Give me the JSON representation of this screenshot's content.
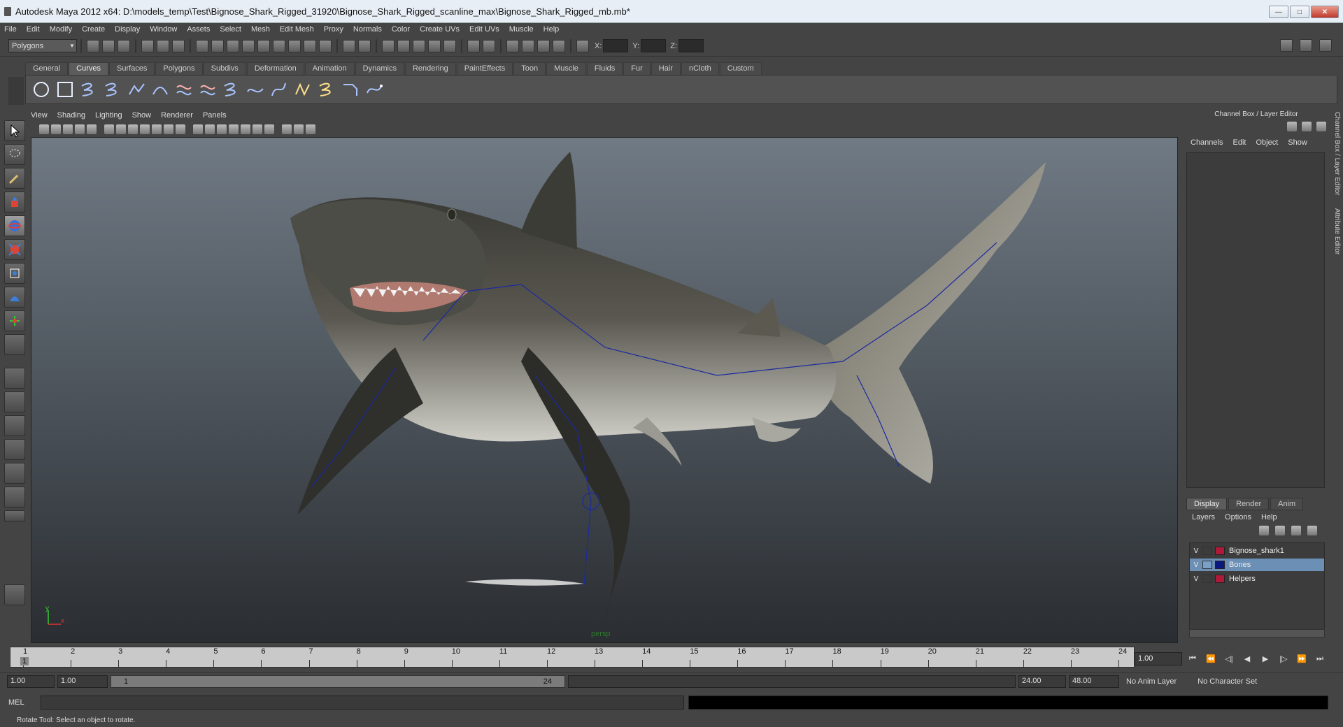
{
  "window": {
    "title": "Autodesk Maya 2012 x64: D:\\models_temp\\Test\\Bignose_Shark_Rigged_31920\\Bignose_Shark_Rigged_scanline_max\\Bignose_Shark_Rigged_mb.mb*",
    "minimize": "—",
    "maximize": "□",
    "close": "✕"
  },
  "menubar": [
    "File",
    "Edit",
    "Modify",
    "Create",
    "Display",
    "Window",
    "Assets",
    "Select",
    "Mesh",
    "Edit Mesh",
    "Proxy",
    "Normals",
    "Color",
    "Create UVs",
    "Edit UVs",
    "Muscle",
    "Help"
  ],
  "status": {
    "mode": "Polygons",
    "x_label": "X:",
    "y_label": "Y:",
    "z_label": "Z:"
  },
  "shelf_tabs": [
    "General",
    "Curves",
    "Surfaces",
    "Polygons",
    "Subdivs",
    "Deformation",
    "Animation",
    "Dynamics",
    "Rendering",
    "PaintEffects",
    "Toon",
    "Muscle",
    "Fluids",
    "Fur",
    "Hair",
    "nCloth",
    "Custom"
  ],
  "active_shelf": "Curves",
  "viewport": {
    "menu": [
      "View",
      "Shading",
      "Lighting",
      "Show",
      "Renderer",
      "Panels"
    ],
    "camera": "persp",
    "axis_y": "y",
    "axis_x": "x"
  },
  "channel_box": {
    "title": "Channel Box / Layer Editor",
    "menu": [
      "Channels",
      "Edit",
      "Object",
      "Show"
    ]
  },
  "side_tabs": [
    "Channel Box / Layer Editor",
    "Attribute Editor"
  ],
  "layer_editor": {
    "tabs": [
      "Display",
      "Render",
      "Anim"
    ],
    "active_tab": "Display",
    "menu": [
      "Layers",
      "Options",
      "Help"
    ],
    "layers": [
      {
        "v": "V",
        "name": "Bignose_shark1",
        "color": "#b01a3a",
        "selected": false
      },
      {
        "v": "V",
        "name": "Bones",
        "color": "#0a1a80",
        "selected": true
      },
      {
        "v": "V",
        "name": "Helpers",
        "color": "#b01a3a",
        "selected": false
      }
    ]
  },
  "timeline": {
    "frames": [
      "1",
      "2",
      "3",
      "4",
      "5",
      "6",
      "7",
      "8",
      "9",
      "10",
      "11",
      "12",
      "13",
      "14",
      "15",
      "16",
      "17",
      "18",
      "19",
      "20",
      "21",
      "22",
      "23",
      "24"
    ],
    "current_frame": "1.00",
    "current_marker": "1"
  },
  "range": {
    "start": "1.00",
    "playback_start": "1.00",
    "slider_start": "1",
    "slider_end": "24",
    "playback_end": "24.00",
    "end": "48.00",
    "anim_layer": "No Anim Layer",
    "char_set": "No Character Set"
  },
  "command": {
    "label": "MEL"
  },
  "help": "Rotate Tool: Select an object to rotate."
}
